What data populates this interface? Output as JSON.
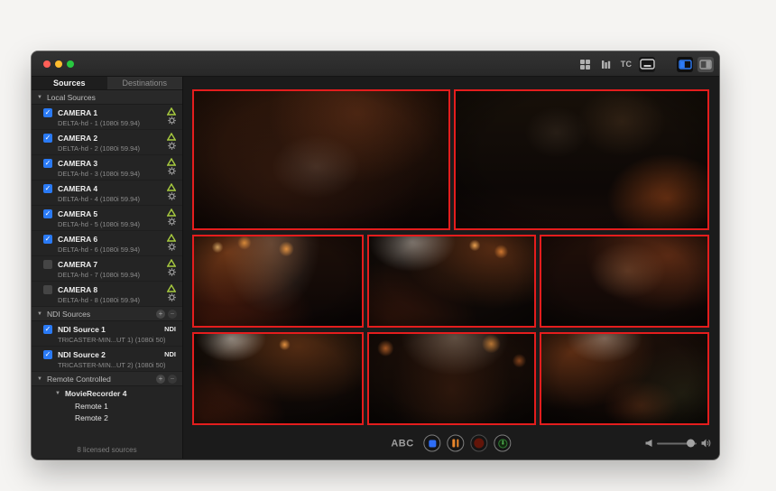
{
  "tabs": {
    "sources": "Sources",
    "destinations": "Destinations"
  },
  "toolbar": {
    "tc_label": "TC"
  },
  "sidebar": {
    "local": {
      "header": "Local Sources",
      "items": [
        {
          "name": "CAMERA 1",
          "subtitle": "DELTA-hd - 1 (1080i 59.94)",
          "checked": true
        },
        {
          "name": "CAMERA 2",
          "subtitle": "DELTA-hd - 2 (1080i 59.94)",
          "checked": true
        },
        {
          "name": "CAMERA 3",
          "subtitle": "DELTA-hd - 3 (1080i 59.94)",
          "checked": true
        },
        {
          "name": "CAMERA 4",
          "subtitle": "DELTA-hd - 4 (1080i 59.94)",
          "checked": true
        },
        {
          "name": "CAMERA 5",
          "subtitle": "DELTA-hd - 5 (1080i 59.94)",
          "checked": true
        },
        {
          "name": "CAMERA 6",
          "subtitle": "DELTA-hd - 6 (1080i 59.94)",
          "checked": true
        },
        {
          "name": "CAMERA 7",
          "subtitle": "DELTA-hd - 7 (1080i 59.94)",
          "checked": false
        },
        {
          "name": "CAMERA 8",
          "subtitle": "DELTA-hd - 8 (1080i 59.94)",
          "checked": false
        }
      ]
    },
    "ndi": {
      "header": "NDI Sources",
      "items": [
        {
          "name": "NDI Source 1",
          "subtitle": "TRICASTER-MIN...UT 1) (1080i 50)",
          "badge": "NDI",
          "checked": true
        },
        {
          "name": "NDI Source 2",
          "subtitle": "TRICASTER-MIN...UT 2) (1080i 50)",
          "badge": "NDI",
          "checked": true
        }
      ]
    },
    "remote": {
      "header": "Remote Controlled",
      "group": "MovieRecorder 4",
      "items": [
        {
          "name": "Remote 1"
        },
        {
          "name": "Remote 2"
        }
      ]
    },
    "footer": "8 licensed sources"
  },
  "transport": {
    "abc_label": "ABC"
  },
  "colors": {
    "tile_border_red": "#e41d1d",
    "checkbox_blue": "#2a7af5",
    "signal_triangle_green": "#a8cb3f",
    "pause_orange": "#e8862b",
    "stop_blue": "#2e6df5",
    "record_red": "#621509",
    "clock_green": "#43a047",
    "panel_toggle_blue": "#2e7bf6"
  }
}
